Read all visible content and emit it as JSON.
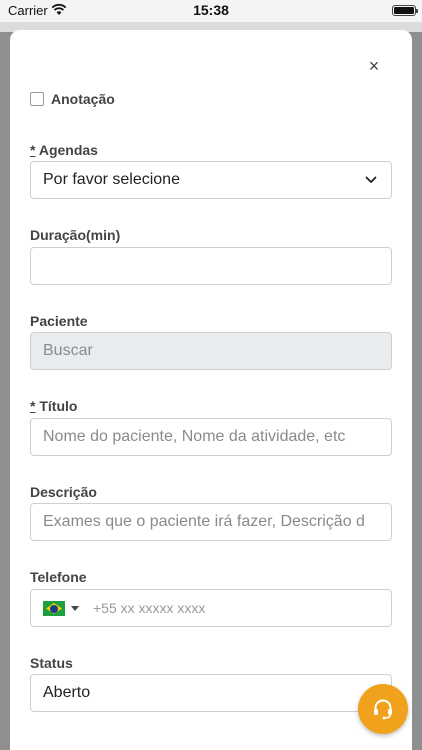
{
  "status_bar": {
    "carrier": "Carrier",
    "time": "15:38"
  },
  "modal": {
    "close_label": "×",
    "annotation_label": "Anotação",
    "fields": {
      "agendas": {
        "required_mark": "*",
        "label": "Agendas",
        "value": "Por favor selecione"
      },
      "duracao": {
        "label": "Duração(min)",
        "value": ""
      },
      "paciente": {
        "label": "Paciente",
        "placeholder": "Buscar"
      },
      "titulo": {
        "required_mark": "*",
        "label": "Título",
        "placeholder": "Nome do paciente, Nome da atividade, etc"
      },
      "descricao": {
        "label": "Descrição",
        "placeholder": "Exames que o paciente irá fazer, Descrição d"
      },
      "telefone": {
        "label": "Telefone",
        "placeholder": "+55 xx xxxxx xxxx",
        "flag_icon": "brazil-flag-icon"
      },
      "status": {
        "label": "Status",
        "value": "Aberto"
      }
    }
  },
  "support": {
    "icon": "headset-icon",
    "color": "#f0a21c"
  }
}
